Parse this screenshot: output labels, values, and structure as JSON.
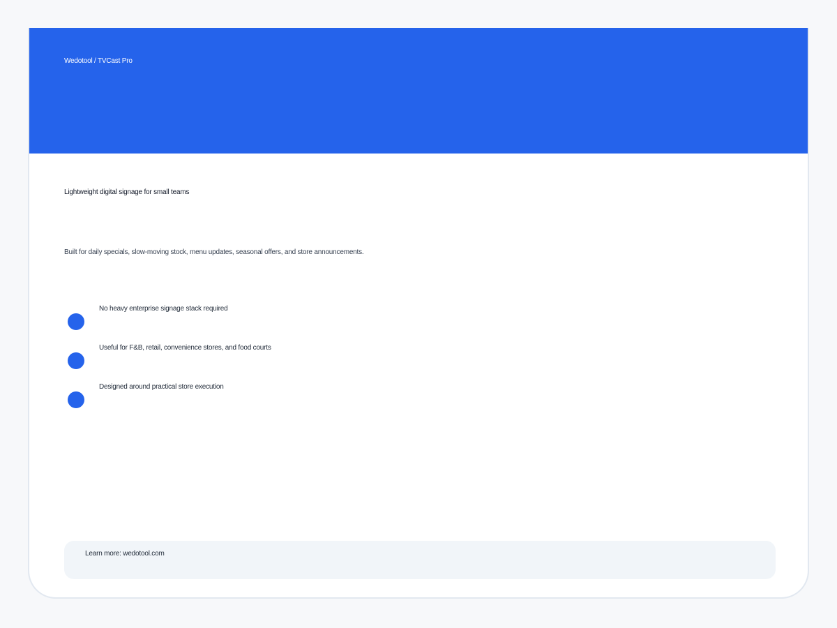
{
  "header": {
    "breadcrumb": "Wedotool / TVCast Pro"
  },
  "main": {
    "headline": "Lightweight digital signage for small teams",
    "description": "Built for daily specials, slow-moving stock, menu updates, seasonal offers, and store announcements.",
    "features": [
      {
        "text": "No heavy enterprise signage stack required"
      },
      {
        "text": "Useful for F&B, retail, convenience stores, and food courts"
      },
      {
        "text": "Designed around practical store execution"
      }
    ]
  },
  "footer": {
    "learn_more": "Learn more: wedotool.com"
  },
  "colors": {
    "accent": "#2563eb",
    "page_background": "#f7f8fa",
    "card_background": "#ffffff",
    "footer_background": "#f1f5f9"
  }
}
